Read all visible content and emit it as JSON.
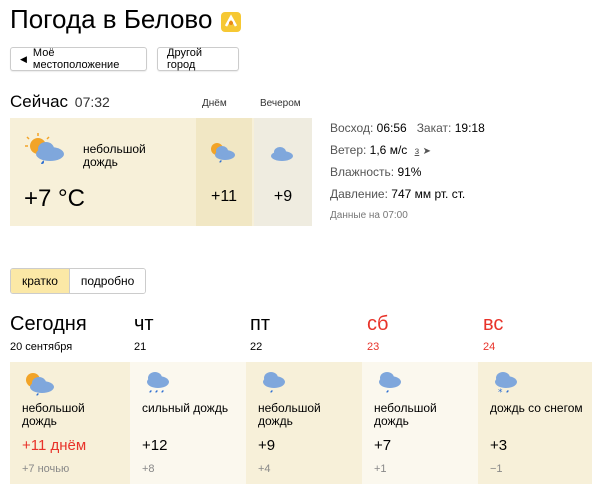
{
  "header": {
    "title": "Погода в Белово"
  },
  "buttons": {
    "location": "Моё местоположение",
    "other_city": "Другой город"
  },
  "now": {
    "label": "Сейчас",
    "time": "07:32",
    "condition": "небольшой дождь",
    "temp": "+7 °C",
    "day_label": "Днём",
    "day_temp": "+11",
    "evening_label": "Вечером",
    "evening_temp": "+9"
  },
  "details": {
    "sunrise_label": "Восход:",
    "sunrise": "06:56",
    "sunset_label": "Закат:",
    "sunset": "19:18",
    "wind_label": "Ветер:",
    "wind": "1,6 м/с",
    "wind_dir": "з",
    "humidity_label": "Влажность:",
    "humidity": "91%",
    "pressure_label": "Давление:",
    "pressure": "747 мм рт. ст.",
    "data_time": "Данные на 07:00"
  },
  "tabs": {
    "short": "кратко",
    "detailed": "подробно"
  },
  "forecast": [
    {
      "day": "Сегодня",
      "date": "20 сентября",
      "condition": "небольшой дождь",
      "temp_day": "+11 днём",
      "temp_night": "+7 ночью"
    },
    {
      "day": "чт",
      "date": "21",
      "condition": "сильный дождь",
      "temp_day": "+12",
      "temp_night": "+8"
    },
    {
      "day": "пт",
      "date": "22",
      "condition": "небольшой дождь",
      "temp_day": "+9",
      "temp_night": "+4"
    },
    {
      "day": "сб",
      "date": "23",
      "condition": "небольшой дождь",
      "temp_day": "+7",
      "temp_night": "+1"
    },
    {
      "day": "вс",
      "date": "24",
      "condition": "дождь со снегом",
      "temp_day": "+3",
      "temp_night": "−1"
    }
  ],
  "icons": {
    "logo": "yandex-logo-icon",
    "location_arrow": "location-arrow-icon",
    "wind_arrow": "wind-arrow-icon",
    "weather": [
      "sun-cloud-rain-icon",
      "cloud-heavy-rain-icon",
      "cloud-rain-icon",
      "cloud-rain-icon",
      "cloud-snow-rain-icon"
    ]
  },
  "colors": {
    "weekend": "#e8332a",
    "accent_tab": "#fbe8a6",
    "panel_bg": "#f7f0d9",
    "cloud": "#7fa7dc",
    "sun": "#f2a428"
  }
}
